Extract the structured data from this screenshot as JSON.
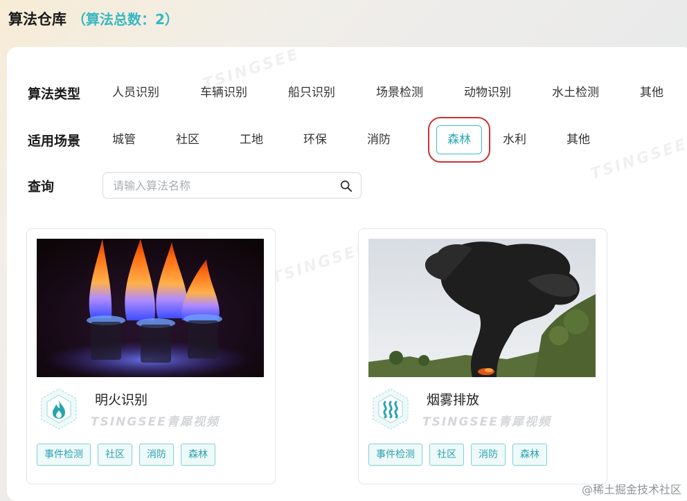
{
  "header": {
    "title": "算法仓库",
    "count_text": "（算法总数：2）"
  },
  "filters": {
    "type": {
      "label": "算法类型",
      "items": [
        "人员识别",
        "车辆识别",
        "船只识别",
        "场景检测",
        "动物识别",
        "水土检测",
        "其他"
      ]
    },
    "scene": {
      "label": "适用场景",
      "items": [
        "城管",
        "社区",
        "工地",
        "环保",
        "消防",
        "森林",
        "水利",
        "其他"
      ],
      "selected": "森林"
    },
    "search": {
      "label": "查询",
      "placeholder": "请输入算法名称",
      "value": ""
    }
  },
  "cards": [
    {
      "name": "明火识别",
      "icon": "flame-icon",
      "watermark": "TSINGSEE青犀视频",
      "tags": [
        "事件检测",
        "社区",
        "消防",
        "森林"
      ]
    },
    {
      "name": "烟雾排放",
      "icon": "smoke-icon",
      "watermark": "TSINGSEE青犀视频",
      "tags": [
        "事件检测",
        "社区",
        "消防",
        "森林"
      ]
    }
  ],
  "credit": "@稀土掘金技术社区",
  "colors": {
    "accent": "#35b8c2",
    "highlight_box": "#c8322f",
    "tag_border": "#7fd0d6"
  }
}
